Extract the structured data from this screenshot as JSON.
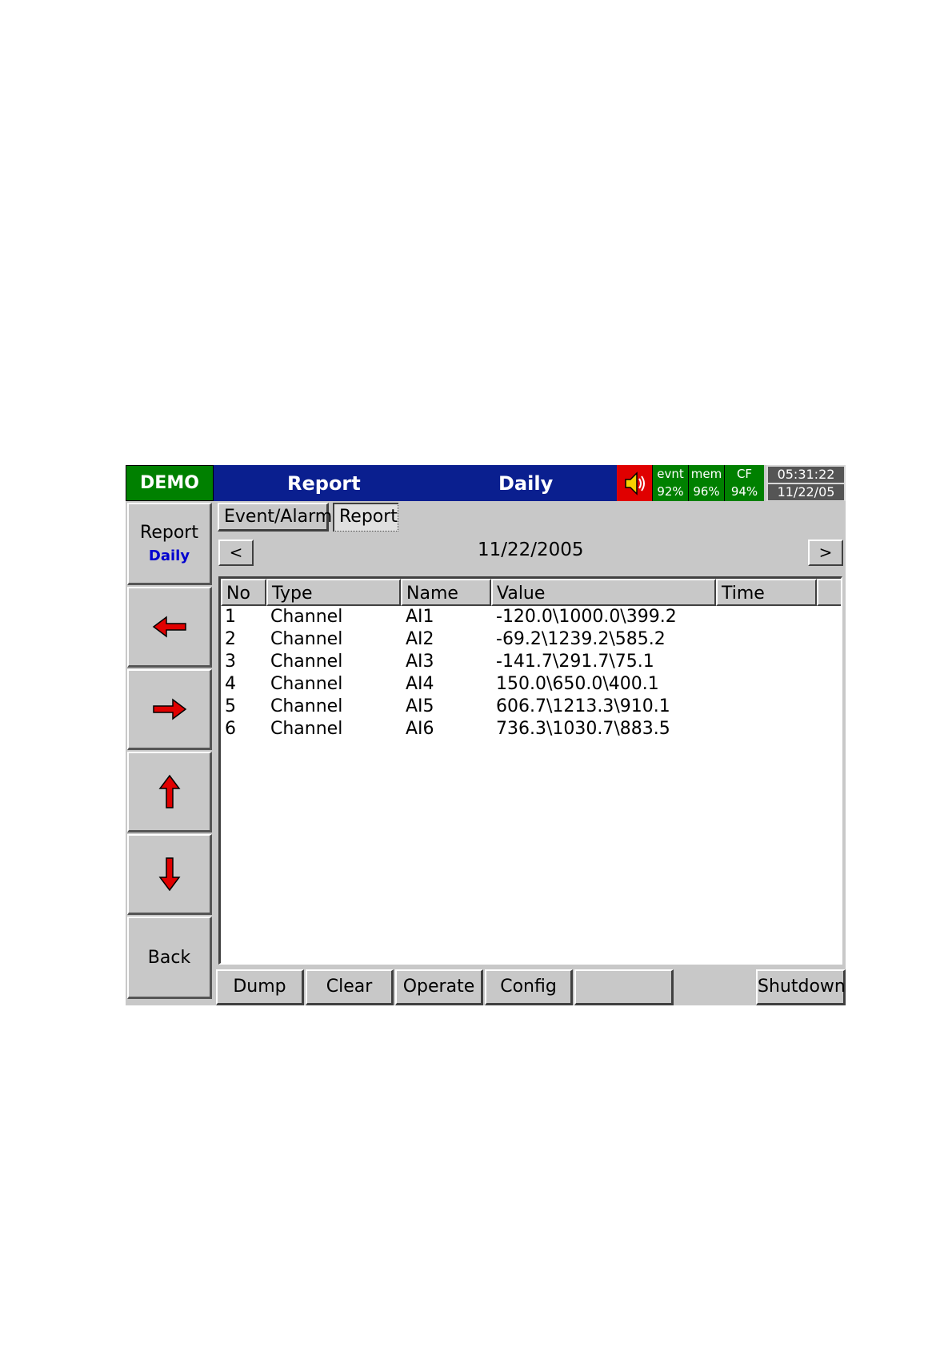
{
  "header": {
    "mode_badge": "DEMO",
    "title": "Report",
    "subtitle": "Daily",
    "status": [
      {
        "label": "evnt",
        "value": "92%"
      },
      {
        "label": "mem",
        "value": "96%"
      },
      {
        "label": "CF",
        "value": "94%"
      }
    ],
    "time": "05:31:22",
    "date": "11/22/05",
    "speaker_icon": "speaker-icon"
  },
  "sidebar": {
    "report_label": "Report",
    "report_sub": "Daily",
    "arrows": [
      "left-arrow-icon",
      "right-arrow-icon",
      "up-arrow-icon",
      "down-arrow-icon"
    ],
    "back_label": "Back"
  },
  "tabs": [
    {
      "label": "Event/Alarm",
      "active": false
    },
    {
      "label": "Report",
      "active": true
    }
  ],
  "nav": {
    "prev_label": "<",
    "next_label": ">",
    "date": "11/22/2005"
  },
  "table": {
    "columns": [
      "No",
      "Type",
      "Name",
      "Value",
      "Time"
    ],
    "rows": [
      {
        "no": "1",
        "type": "Channel",
        "name": "AI1",
        "value": "-120.0\\1000.0\\399.2",
        "time": ""
      },
      {
        "no": "2",
        "type": "Channel",
        "name": "AI2",
        "value": "-69.2\\1239.2\\585.2",
        "time": ""
      },
      {
        "no": "3",
        "type": "Channel",
        "name": "AI3",
        "value": "-141.7\\291.7\\75.1",
        "time": ""
      },
      {
        "no": "4",
        "type": "Channel",
        "name": "AI4",
        "value": "150.0\\650.0\\400.1",
        "time": ""
      },
      {
        "no": "5",
        "type": "Channel",
        "name": "AI5",
        "value": "606.7\\1213.3\\910.1",
        "time": ""
      },
      {
        "no": "6",
        "type": "Channel",
        "name": "AI6",
        "value": "736.3\\1030.7\\883.5",
        "time": ""
      }
    ]
  },
  "footer": {
    "dump": "Dump",
    "clear": "Clear",
    "operate": "Operate",
    "config": "Config",
    "blank": "",
    "shutdown": "Shutdown"
  },
  "colors": {
    "header_blue": "#0a1f8f",
    "status_green": "#008000",
    "arrow_red": "#e00000",
    "sub_label_blue": "#0000d0"
  }
}
